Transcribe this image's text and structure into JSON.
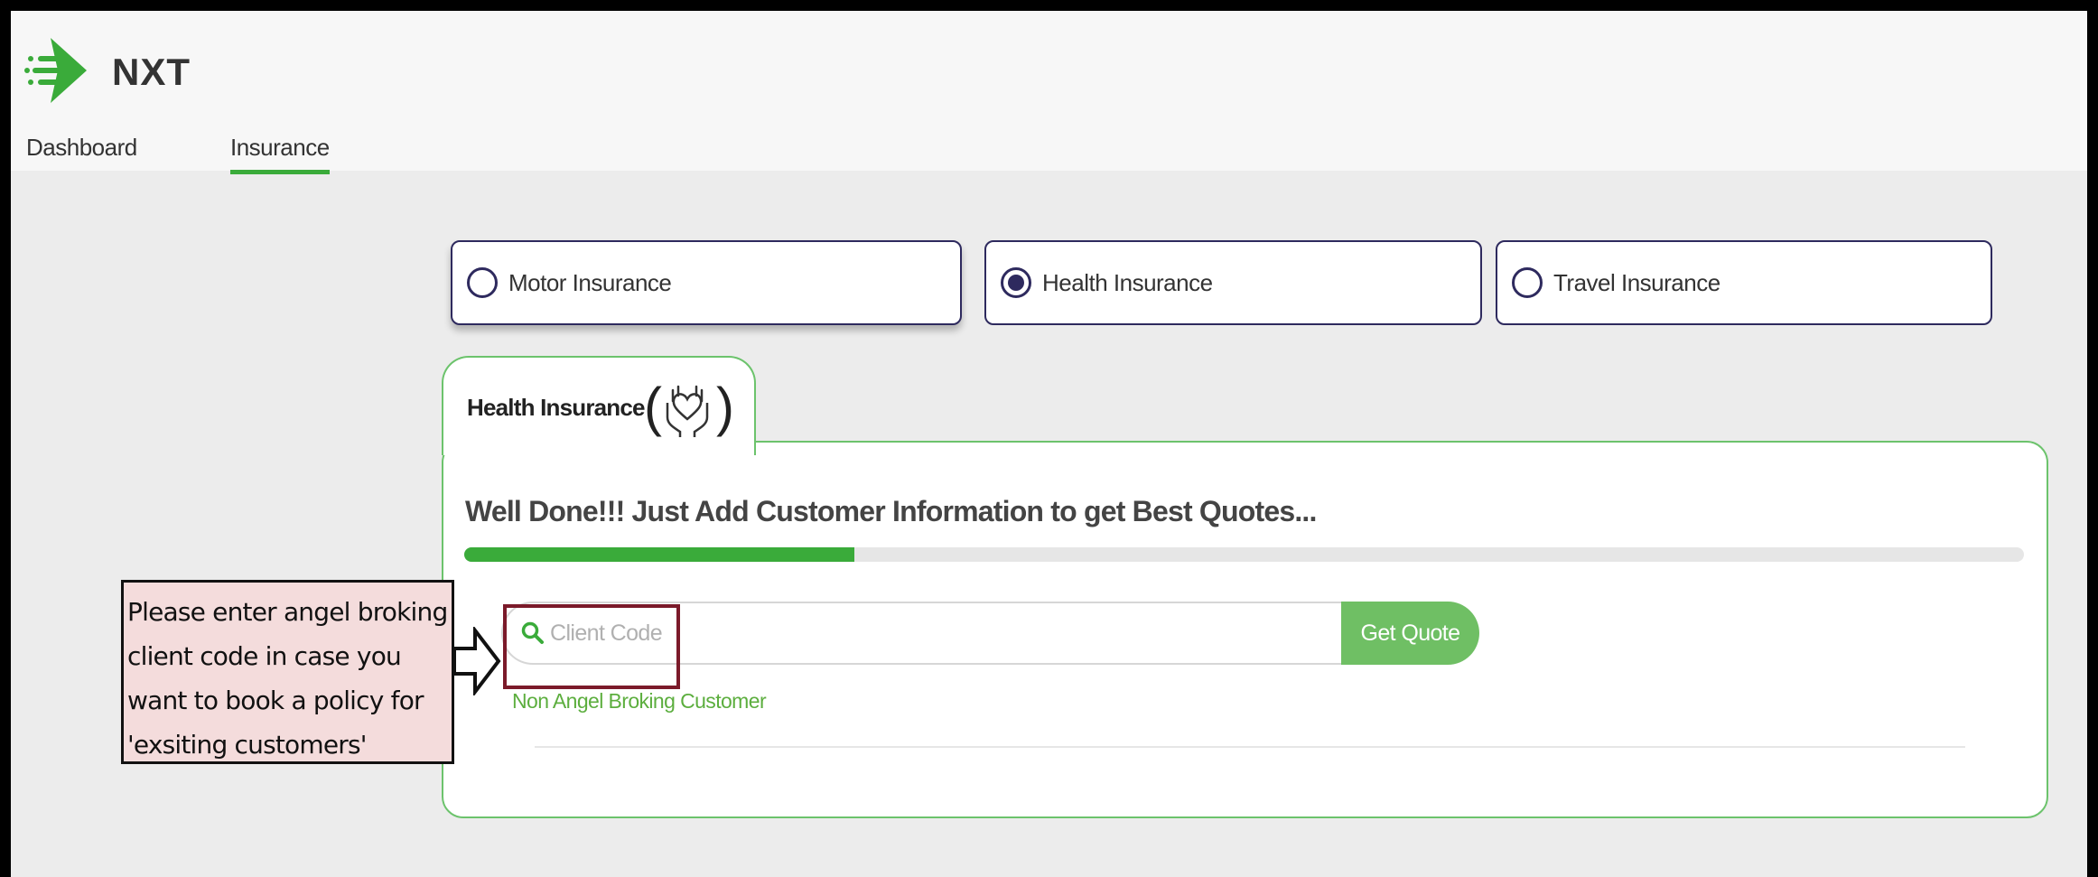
{
  "app": {
    "logo_text": "NXT"
  },
  "nav": {
    "tabs": [
      {
        "label": "Dashboard"
      },
      {
        "label": "Insurance",
        "active": true
      }
    ]
  },
  "insurance_types": [
    {
      "label": "Motor Insurance",
      "selected": false
    },
    {
      "label": "Health Insurance",
      "selected": true
    },
    {
      "label": "Travel Insurance",
      "selected": false
    }
  ],
  "panel": {
    "tab_title": "Health Insurance",
    "heading": "Well Done!!! Just Add Customer Information to get Best Quotes...",
    "progress_percent": 25,
    "search": {
      "placeholder": "Client Code",
      "value": ""
    },
    "get_quote_label": "Get Quote",
    "non_customer_link": "Non Angel Broking Customer"
  },
  "callout": {
    "text": "Please enter angel broking\nclient code in case you\nwant to book a policy for\n'exsiting customers'"
  },
  "colors": {
    "accent_green": "#3aab3a",
    "button_green": "#6fbf64",
    "navy": "#2e2a5e",
    "highlight_border": "#7b1a2a",
    "callout_bg": "#f4dcdc"
  },
  "icons": [
    "nxt-logo-icon",
    "search-icon",
    "hands-heart-icon",
    "arrow-right-icon",
    "radio-icon"
  ]
}
